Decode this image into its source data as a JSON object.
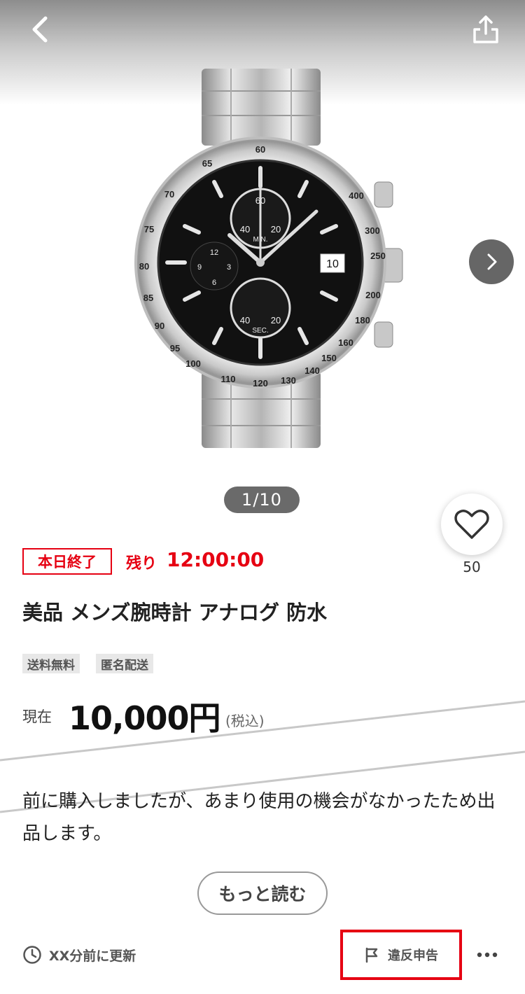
{
  "header": {
    "back_icon": "chevron-left-icon",
    "share_icon": "share-icon"
  },
  "gallery": {
    "counter": "1/10",
    "next_icon": "chevron-right-icon",
    "dial_numbers": [
      "60",
      "40",
      "20",
      "MIN.",
      "12",
      "9",
      "3",
      "6",
      "40",
      "20",
      "SEC."
    ],
    "bezel_numbers": [
      "60",
      "65",
      "70",
      "75",
      "80",
      "85",
      "90",
      "95",
      "100",
      "110",
      "120",
      "130",
      "140",
      "150",
      "160",
      "180",
      "200",
      "250",
      "300",
      "400"
    ]
  },
  "favorite": {
    "icon": "heart-icon",
    "count": "50"
  },
  "auction": {
    "ending_badge": "本日終了",
    "remaining_label": "残り",
    "remaining_time": "12:00:00"
  },
  "item": {
    "title": "美品 メンズ腕時計 アナログ 防水",
    "tags": [
      "送料無料",
      "匿名配送"
    ]
  },
  "price": {
    "label": "現在",
    "value": "10,000円",
    "tax_note": "(税込)"
  },
  "description": {
    "text": "前に購入しましたが、あまり使用の機会がなかったため出品します。",
    "more_label": "もっと読む"
  },
  "footer": {
    "updated_icon": "clock-icon",
    "updated_text": "XX分前に更新",
    "report_icon": "flag-icon",
    "report_label": "違反申告",
    "more_icon": "more-dots-icon"
  },
  "colors": {
    "accent_red": "#e60012",
    "overlay_gray": "#666666"
  }
}
